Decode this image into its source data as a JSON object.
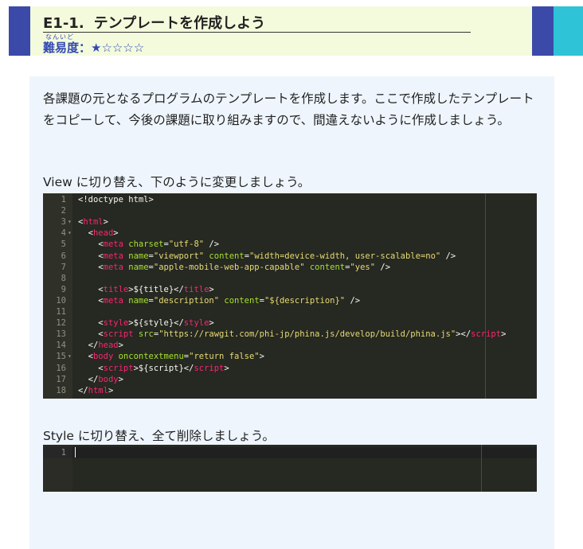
{
  "header": {
    "number": "E1-1.",
    "title": "テンプレートを作成しよう",
    "difficulty_ruby": "なんいど",
    "difficulty_label": "難易度：",
    "difficulty_stars": "★☆☆☆☆",
    "difficulty_rating": 1,
    "difficulty_max": 5
  },
  "content": {
    "intro": "各課題の元となるプログラムのテンプレートを作成します。ここで作成したテンプレートをコピーして、今後の課題に取り組みますので、間違えないように作成しましょう。",
    "view_instruction": "View に切り替え、下のように変更しましょう。",
    "style_instruction": "Style に切り替え、全て削除しましょう。"
  },
  "view_editor": {
    "lines": [
      {
        "n": "1",
        "fold": "",
        "html": "&lt;!doctype html&gt;"
      },
      {
        "n": "2",
        "fold": "",
        "html": ""
      },
      {
        "n": "3",
        "fold": "▾",
        "html": "<span class=\"pl\">&lt;</span><span class=\"tag\">html</span><span class=\"pl\">&gt;</span>"
      },
      {
        "n": "4",
        "fold": "▾",
        "html": "  <span class=\"pl\">&lt;</span><span class=\"tag\">head</span><span class=\"pl\">&gt;</span>"
      },
      {
        "n": "5",
        "fold": "",
        "html": "    <span class=\"pl\">&lt;</span><span class=\"tag\">meta</span> <span class=\"attr\">charset</span>=<span class=\"str\">\"utf-8\"</span> /&gt;"
      },
      {
        "n": "6",
        "fold": "",
        "html": "    <span class=\"pl\">&lt;</span><span class=\"tag\">meta</span> <span class=\"attr\">name</span>=<span class=\"str\">\"viewport\"</span> <span class=\"attr\">content</span>=<span class=\"str\">\"width=device-width, user-scalable=no\"</span> /&gt;"
      },
      {
        "n": "7",
        "fold": "",
        "html": "    <span class=\"pl\">&lt;</span><span class=\"tag\">meta</span> <span class=\"attr\">name</span>=<span class=\"str\">\"apple-mobile-web-app-capable\"</span> <span class=\"attr\">content</span>=<span class=\"str\">\"yes\"</span> /&gt;"
      },
      {
        "n": "8",
        "fold": "",
        "html": ""
      },
      {
        "n": "9",
        "fold": "",
        "html": "    <span class=\"pl\">&lt;</span><span class=\"tag\">title</span><span class=\"pl\">&gt;</span>${title}<span class=\"pl\">&lt;/</span><span class=\"tag\">title</span><span class=\"pl\">&gt;</span>"
      },
      {
        "n": "10",
        "fold": "",
        "html": "    <span class=\"pl\">&lt;</span><span class=\"tag\">meta</span> <span class=\"attr\">name</span>=<span class=\"str\">\"description\"</span> <span class=\"attr\">content</span>=<span class=\"str\">\"${description}\"</span> /&gt;"
      },
      {
        "n": "11",
        "fold": "",
        "html": ""
      },
      {
        "n": "12",
        "fold": "",
        "html": "    <span class=\"pl\">&lt;</span><span class=\"tag\">style</span><span class=\"pl\">&gt;</span>${style}<span class=\"pl\">&lt;/</span><span class=\"tag\">style</span><span class=\"pl\">&gt;</span>"
      },
      {
        "n": "13",
        "fold": "",
        "html": "    <span class=\"pl\">&lt;</span><span class=\"tag\">script</span> <span class=\"attr\">src</span>=<span class=\"str\">\"https://rawgit.com/phi-jp/phina.js/develop/build/phina.js\"</span><span class=\"pl\">&gt;&lt;/</span><span class=\"tag\">script</span><span class=\"pl\">&gt;</span>"
      },
      {
        "n": "14",
        "fold": "",
        "html": "  <span class=\"pl\">&lt;/</span><span class=\"tag\">head</span><span class=\"pl\">&gt;</span>"
      },
      {
        "n": "15",
        "fold": "▾",
        "html": "  <span class=\"pl\">&lt;</span><span class=\"tag\">body</span> <span class=\"attr\">oncontextmenu</span>=<span class=\"str\">\"return false\"</span><span class=\"pl\">&gt;</span>"
      },
      {
        "n": "16",
        "fold": "",
        "html": "    <span class=\"pl\">&lt;</span><span class=\"tag\">script</span><span class=\"pl\">&gt;</span>${script}<span class=\"pl\">&lt;/</span><span class=\"tag\">script</span><span class=\"pl\">&gt;</span>"
      },
      {
        "n": "17",
        "fold": "",
        "html": "  <span class=\"pl\">&lt;/</span><span class=\"tag\">body</span><span class=\"pl\">&gt;</span>"
      },
      {
        "n": "18",
        "fold": "",
        "html": "<span class=\"pl\">&lt;/</span><span class=\"tag\">html</span><span class=\"pl\">&gt;</span>"
      }
    ]
  },
  "style_editor": {
    "lines": [
      {
        "n": "1",
        "fold": "",
        "html": ""
      }
    ]
  },
  "colors": {
    "brand_blue": "#3b4aa8",
    "brand_cyan": "#2ec3d6",
    "header_bg": "#f4fbdc",
    "panel_bg": "#eef5fd",
    "editor_bg": "#262822",
    "difficulty": "#3448b6"
  }
}
